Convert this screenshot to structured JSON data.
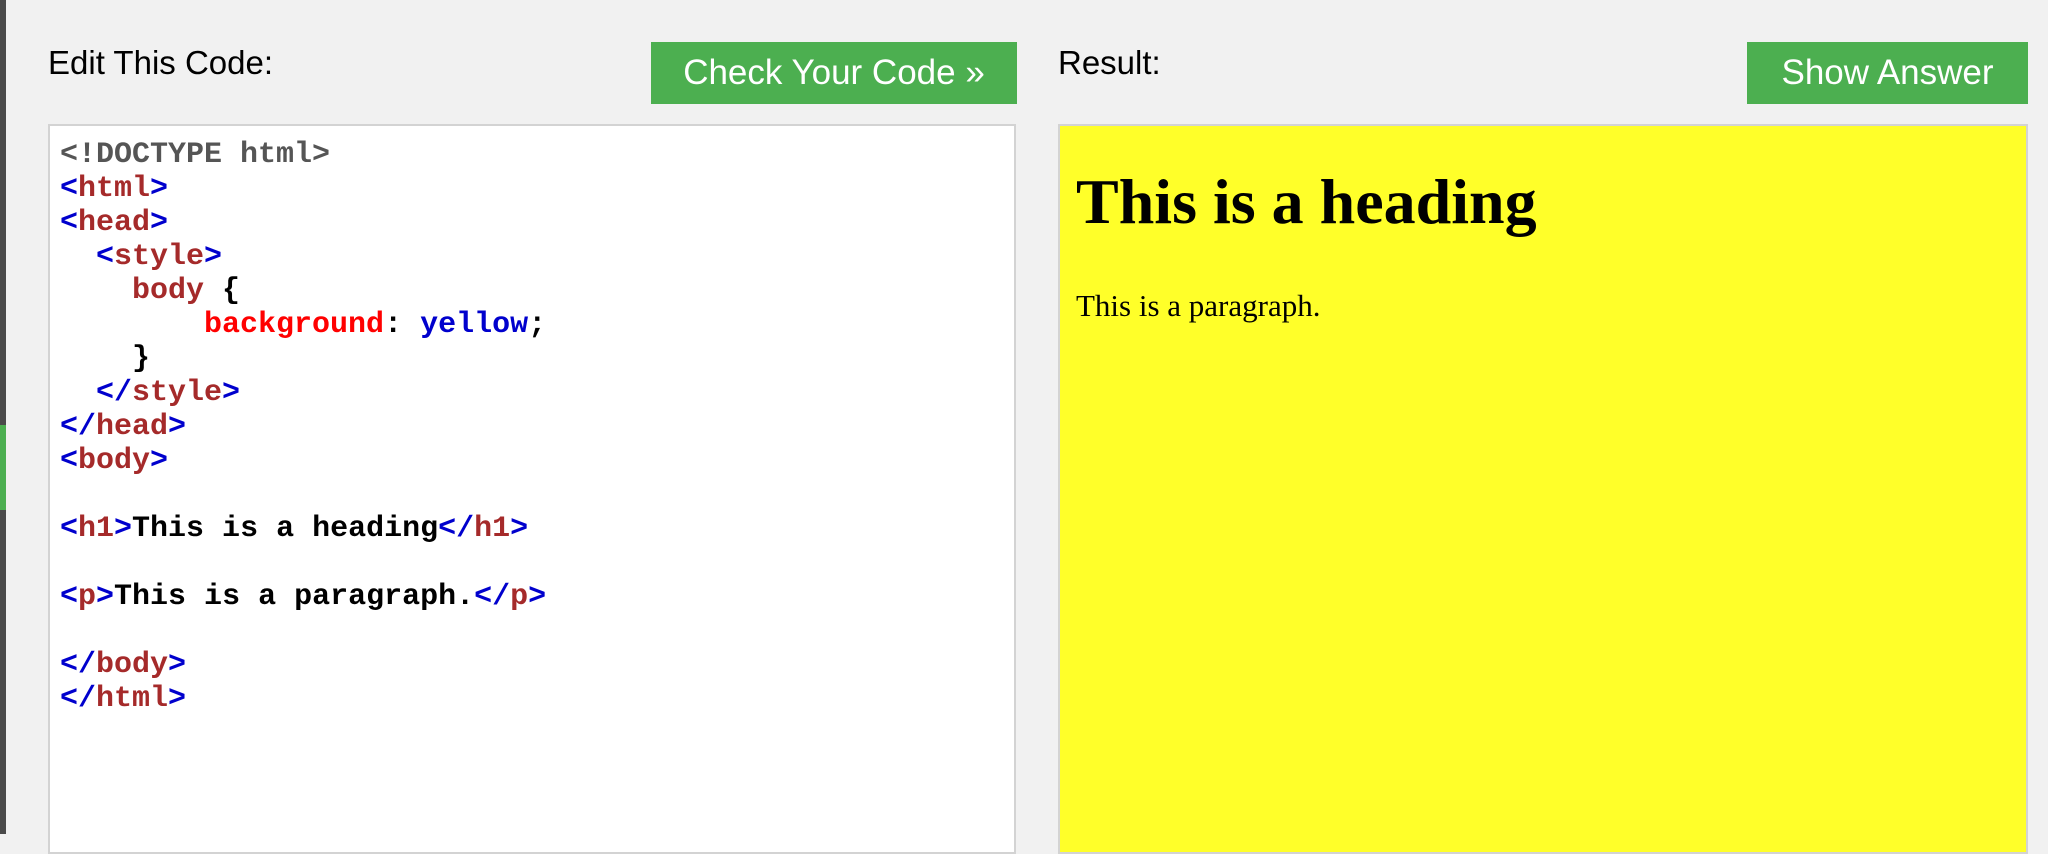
{
  "editor_panel": {
    "title": "Edit This Code:",
    "check_button_label": "Check Your Code »",
    "code_lines": [
      [
        {
          "t": "doctype",
          "v": "<!DOCTYPE html>"
        }
      ],
      [
        {
          "t": "br",
          "v": "<"
        },
        {
          "t": "tag",
          "v": "html"
        },
        {
          "t": "br",
          "v": ">"
        }
      ],
      [
        {
          "t": "br",
          "v": "<"
        },
        {
          "t": "tag",
          "v": "head"
        },
        {
          "t": "br",
          "v": ">"
        }
      ],
      [
        {
          "t": "txt",
          "v": "  "
        },
        {
          "t": "br",
          "v": "<"
        },
        {
          "t": "tag",
          "v": "style"
        },
        {
          "t": "br",
          "v": ">"
        }
      ],
      [
        {
          "t": "txt",
          "v": "    "
        },
        {
          "t": "tag",
          "v": "body"
        },
        {
          "t": "txt",
          "v": " {"
        }
      ],
      [
        {
          "t": "txt",
          "v": "        "
        },
        {
          "t": "prop",
          "v": "background"
        },
        {
          "t": "txt",
          "v": ": "
        },
        {
          "t": "val",
          "v": "yellow"
        },
        {
          "t": "txt",
          "v": ";"
        }
      ],
      [
        {
          "t": "txt",
          "v": "    }"
        }
      ],
      [
        {
          "t": "txt",
          "v": "  "
        },
        {
          "t": "br",
          "v": "</"
        },
        {
          "t": "tag",
          "v": "style"
        },
        {
          "t": "br",
          "v": ">"
        }
      ],
      [
        {
          "t": "br",
          "v": "</"
        },
        {
          "t": "tag",
          "v": "head"
        },
        {
          "t": "br",
          "v": ">"
        }
      ],
      [
        {
          "t": "br",
          "v": "<"
        },
        {
          "t": "tag",
          "v": "body"
        },
        {
          "t": "br",
          "v": ">"
        }
      ],
      [],
      [
        {
          "t": "br",
          "v": "<"
        },
        {
          "t": "tag",
          "v": "h1"
        },
        {
          "t": "br",
          "v": ">"
        },
        {
          "t": "txt",
          "v": "This is a heading"
        },
        {
          "t": "br",
          "v": "</"
        },
        {
          "t": "tag",
          "v": "h1"
        },
        {
          "t": "br",
          "v": ">"
        }
      ],
      [],
      [
        {
          "t": "br",
          "v": "<"
        },
        {
          "t": "tag",
          "v": "p"
        },
        {
          "t": "br",
          "v": ">"
        },
        {
          "t": "txt",
          "v": "This is a paragraph."
        },
        {
          "t": "br",
          "v": "</"
        },
        {
          "t": "tag",
          "v": "p"
        },
        {
          "t": "br",
          "v": ">"
        }
      ],
      [],
      [
        {
          "t": "br",
          "v": "</"
        },
        {
          "t": "tag",
          "v": "body"
        },
        {
          "t": "br",
          "v": ">"
        }
      ],
      [
        {
          "t": "br",
          "v": "</"
        },
        {
          "t": "tag",
          "v": "html"
        },
        {
          "t": "br",
          "v": ">"
        }
      ]
    ]
  },
  "result_panel": {
    "title": "Result:",
    "show_answer_label": "Show Answer",
    "heading": "This is a heading",
    "paragraph": "This is a paragraph."
  },
  "colors": {
    "button_green": "#4CAF50",
    "result_background": "#ffff29",
    "page_background": "#f1f1f1",
    "syntax_bracket": "#0000cd",
    "syntax_tag": "#a52a2a",
    "syntax_property": "#ff0000",
    "syntax_value": "#0000cd",
    "syntax_doctype": "#555555"
  }
}
